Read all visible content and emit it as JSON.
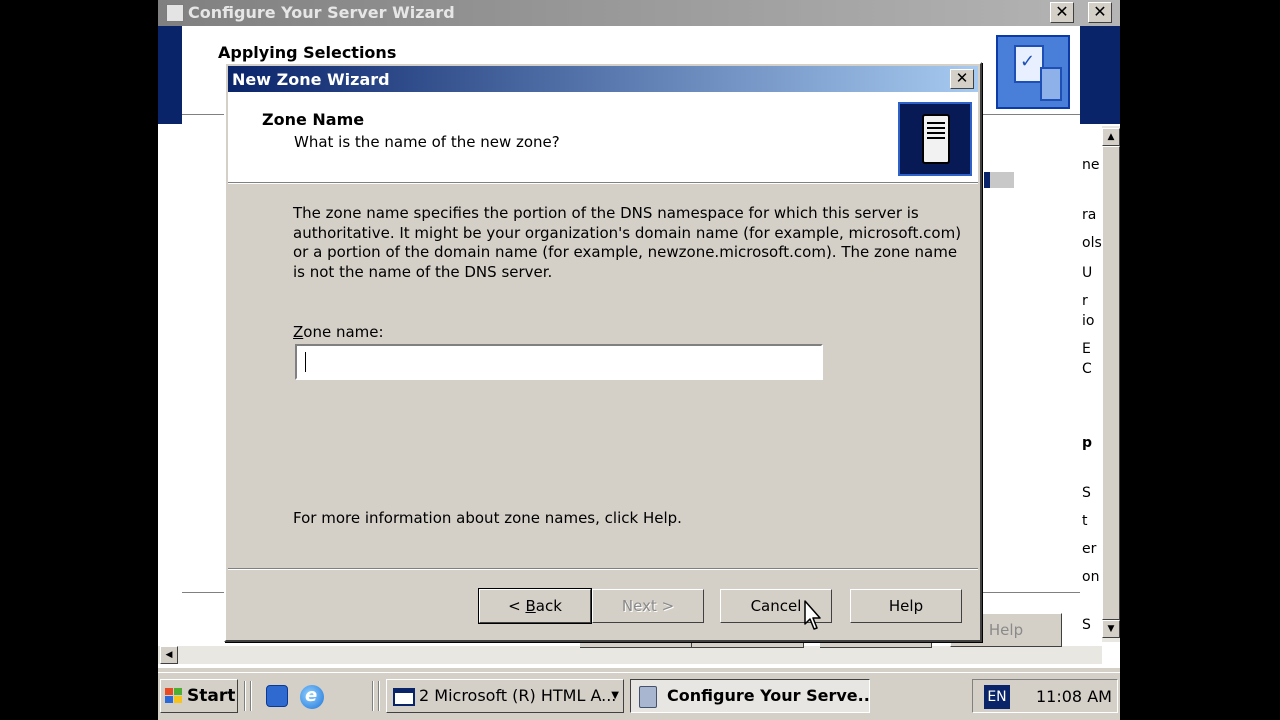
{
  "background_window": {
    "title": "Configure Your Server Wizard",
    "heading": "Applying Selections",
    "help_label": "Help",
    "side_fragments": [
      "ne",
      "ra",
      "ols",
      "U",
      "r",
      "io",
      "E",
      "C",
      "p",
      "S",
      "t",
      "er",
      "on",
      "S"
    ],
    "close_glyph": "✕"
  },
  "dialog": {
    "title": "New Zone Wizard",
    "close_glyph": "✕",
    "heading": "Zone Name",
    "subheading": "What is the name of the new zone?",
    "description": "The zone name specifies the portion of the DNS namespace for which this server is authoritative. It might be your organization's domain name (for example,  microsoft.com) or a portion of the domain name (for example, newzone.microsoft.com). The zone name is not the name of the DNS server.",
    "zone_label_mnemonic": "Z",
    "zone_label_rest": "one name:",
    "zone_value": "",
    "help_text": "For more information about zone names, click Help.",
    "buttons": {
      "back_prefix": "< ",
      "back_mnemonic": "B",
      "back_rest": "ack",
      "next": "Next >",
      "cancel": "Cancel",
      "help": "Help"
    }
  },
  "taskbar": {
    "start_label": "Start",
    "tasks": [
      "2 Microsoft (R) HTML A...",
      "Configure Your Serve..."
    ],
    "language": "EN",
    "clock": "11:08 AM"
  },
  "icons": {
    "cursor": "arrow-cursor-icon",
    "scroll_up": "▲",
    "scroll_down": "▼",
    "scroll_left": "◀",
    "dropdown": "▼"
  },
  "colors": {
    "active_title_start": "#0a246a",
    "active_title_end": "#a6caf0",
    "face": "#d4d0c8"
  }
}
